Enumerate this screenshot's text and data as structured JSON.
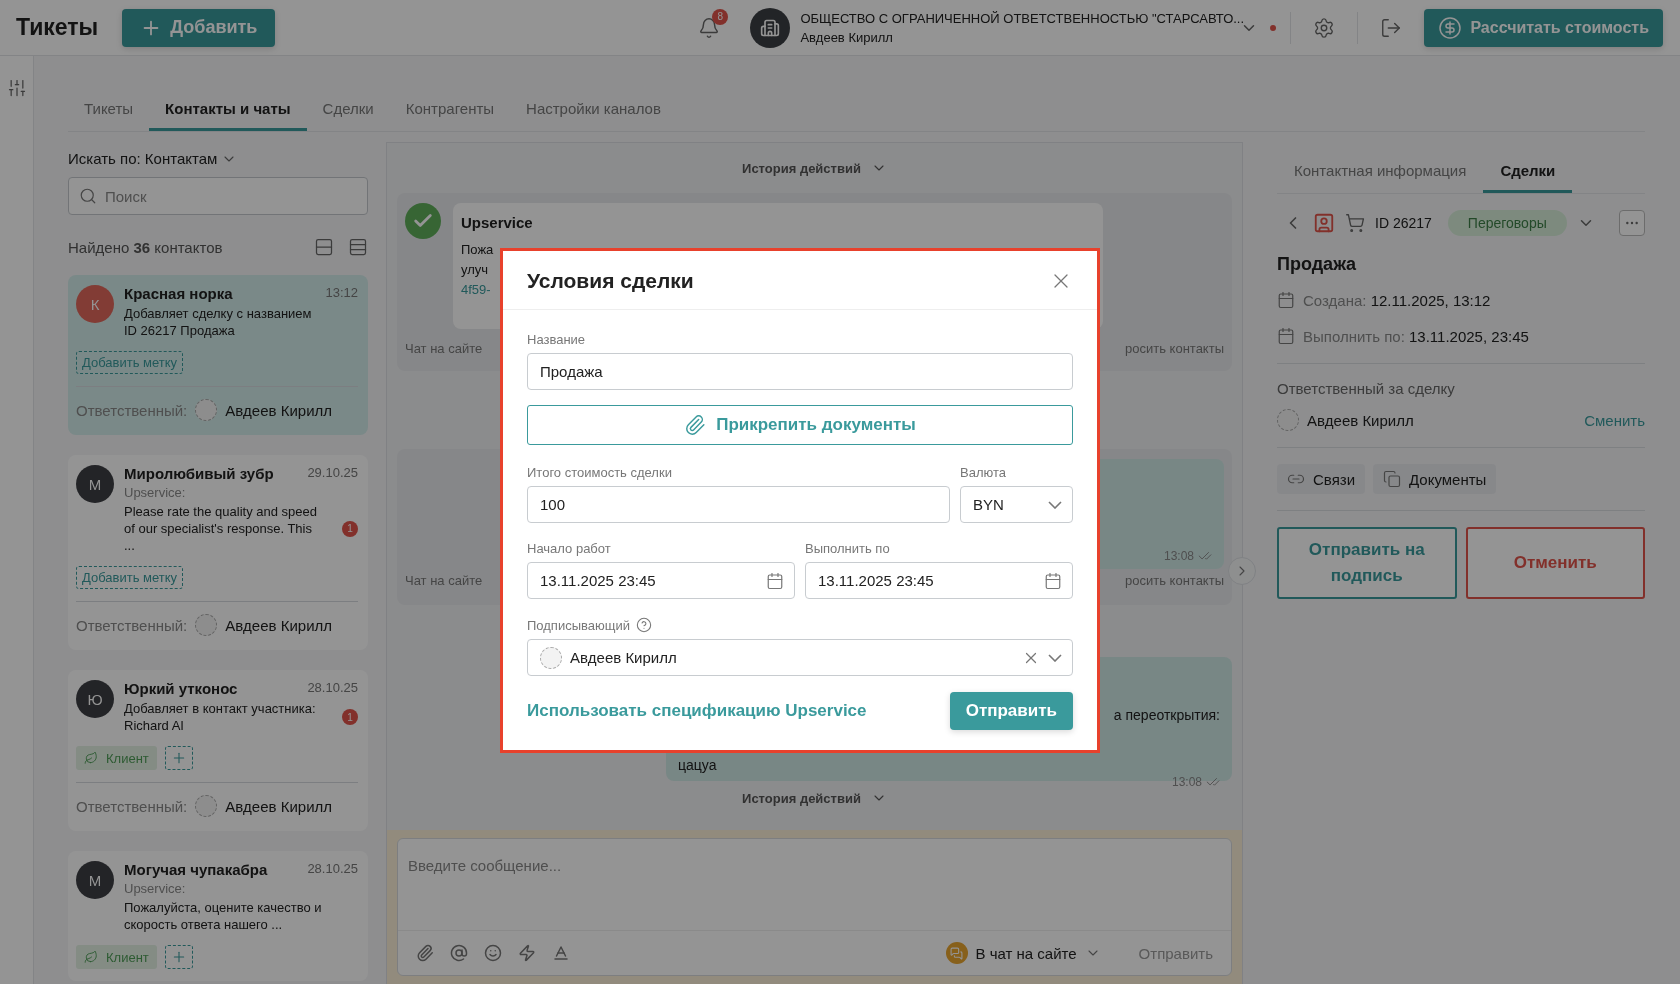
{
  "header": {
    "title": "Тикеты",
    "add_button": "Добавить",
    "notifications": "8",
    "organization": "ОБЩЕСТВО С ОГРАНИЧЕННОЙ ОТВЕТСТВЕННОСТЬЮ \"СТАРСАВТО...",
    "user": "Авдеев Кирилл",
    "calc_button": "Рассчитать стоимость"
  },
  "tabs": [
    {
      "label": "Тикеты",
      "selected": false
    },
    {
      "label": "Контакты и чаты",
      "selected": true
    },
    {
      "label": "Сделки",
      "selected": false
    },
    {
      "label": "Контрагенты",
      "selected": false
    },
    {
      "label": "Настройки каналов",
      "selected": false
    }
  ],
  "contacts": {
    "search_by": "Искать по: Контактам",
    "search_placeholder": "Поиск",
    "found": "Найдено **36** контактов",
    "items": [
      {
        "initial": "К",
        "color": "#823c35",
        "name": "Красная норка",
        "time": "13:12",
        "text": "Добавляет сделку с названием ID 26217 Продажа",
        "selected": true,
        "tags": [
          {
            "kind": "add_label",
            "label": "Добавить метку"
          }
        ],
        "responsible_label": "Ответственный:",
        "responsible": "Авдеев Кирилл"
      },
      {
        "initial": "М",
        "color": "#232427",
        "name": "Миролюбивый зубр",
        "time": "29.10.25",
        "source": "Upservice:",
        "text": "Please rate the quality and speed of our specialist's response. This ...",
        "unread": "1",
        "selected": false,
        "tags": [
          {
            "kind": "add_label",
            "label": "Добавить метку"
          }
        ],
        "responsible_label": "Ответственный:",
        "responsible": "Авдеев Кирилл"
      },
      {
        "initial": "Ю",
        "color": "#232427",
        "name": "Юркий утконос",
        "time": "28.10.25",
        "text": "Добавляет в контакт участника: Richard AI",
        "unread": "1",
        "selected": false,
        "tags": [
          {
            "kind": "client",
            "label": "Клиент"
          },
          {
            "kind": "add"
          }
        ],
        "responsible_label": "Ответственный:",
        "responsible": "Авдеев Кирилл"
      },
      {
        "initial": "М",
        "color": "#232427",
        "name": "Могучая чупакабра",
        "time": "28.10.25",
        "source": "Upservice:",
        "text": "Пожалуйста, оцените качество и скорость ответа нашего ...",
        "selected": false,
        "tags": [
          {
            "kind": "client",
            "label": "Клиент"
          },
          {
            "kind": "add"
          }
        ]
      }
    ]
  },
  "chat": {
    "history_top": "История действий",
    "messages": [
      {
        "kind": "bot",
        "sender": "Upservice",
        "lines": [
          "Пожа",
          "улуч"
        ],
        "link": "4f59-",
        "channel": "Чат на сайте",
        "action": "росить контакты"
      },
      {
        "kind": "outgoing_card",
        "time": "13:08",
        "channel": "Чат на сайте",
        "action": "росить контакты"
      },
      {
        "kind": "outgoing",
        "line_end": "а переоткрытия:",
        "line_start": "цацуа",
        "time": "13:08"
      }
    ],
    "history_bottom": "История действий",
    "composer": {
      "placeholder": "Введите сообщение...",
      "channel": "В чат на сайте",
      "send": "Отправить"
    }
  },
  "details": {
    "tabs": [
      {
        "label": "Контактная информация",
        "selected": false
      },
      {
        "label": "Сделки",
        "selected": true
      }
    ],
    "deal_id": "ID 26217",
    "stage": "Переговоры",
    "title": "Продажа",
    "created_label": "Создана:",
    "created": "12.11.2025, 13:12",
    "due_label": "Выполнить по:",
    "due": "13.11.2025, 23:45",
    "responsible_label": "Ответственный за сделку",
    "responsible": "Авдеев Кирилл",
    "change_link": "Сменить",
    "chips": [
      {
        "kind": "links",
        "label": "Связи"
      },
      {
        "kind": "documents",
        "label": "Документы"
      }
    ],
    "sign_button": "Отправить на подпись",
    "cancel_button": "Отменить"
  },
  "deal_dialog": {
    "title": "Условия сделки",
    "name_label": "Название",
    "name": "Продажа",
    "attach_button": "Прикрепить документы",
    "total_label": "Итого стоимость сделки",
    "total": "100",
    "currency_label": "Валюта",
    "currency": "BYN",
    "start_label": "Начало работ",
    "start": "13.11.2025 23:45",
    "due_label": "Выполнить по",
    "due": "13.11.2025 23:45",
    "signer_label": "Подписывающий",
    "signer": "Авдеев Кирилл",
    "spec_link": "Использовать спецификацию Upservice",
    "submit": "Отправить"
  }
}
